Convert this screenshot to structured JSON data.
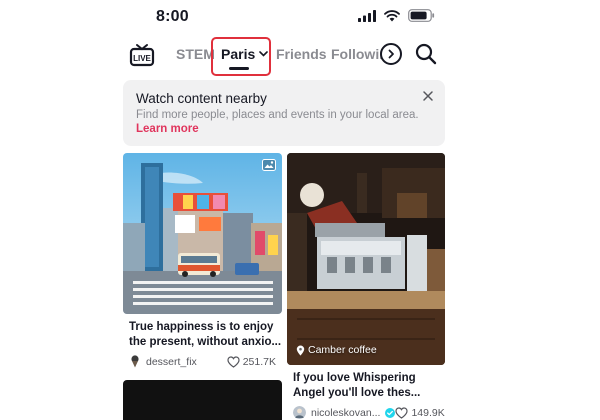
{
  "status_bar": {
    "time": "8:00",
    "icons": [
      "signal-icon",
      "wifi-icon",
      "battery-icon"
    ]
  },
  "nav": {
    "live_icon": "live-tv-icon",
    "tabs": [
      {
        "label": "STEM",
        "active": false
      },
      {
        "label": "Paris",
        "active": true,
        "has_dropdown": true
      },
      {
        "label": "Friends",
        "active": false
      },
      {
        "label": "Following",
        "active": false
      }
    ],
    "more_icon": "chevron-right-circle-icon",
    "search_icon": "search-icon"
  },
  "banner": {
    "title": "Watch content nearby",
    "body": "Find more people, places and events in your local area.",
    "link": "Learn more",
    "close_icon": "close-icon"
  },
  "feed": [
    {
      "caption": "True happiness is to enjoy the present, without anxio...",
      "author": "dessert_fix",
      "likes": "251.7K",
      "badge_icon": "photo-mode-icon"
    },
    {
      "location": "Camber coffee",
      "caption": "If you love Whispering Angel you'll love thes...",
      "author": "nicoleskovan...",
      "verified": true,
      "likes": "149.9K"
    }
  ],
  "colors": {
    "accent": "#e0355d",
    "highlight_border": "#e0303c",
    "text_primary": "#161823",
    "text_secondary": "#8a8b91",
    "banner_bg": "#f1f1f2"
  }
}
